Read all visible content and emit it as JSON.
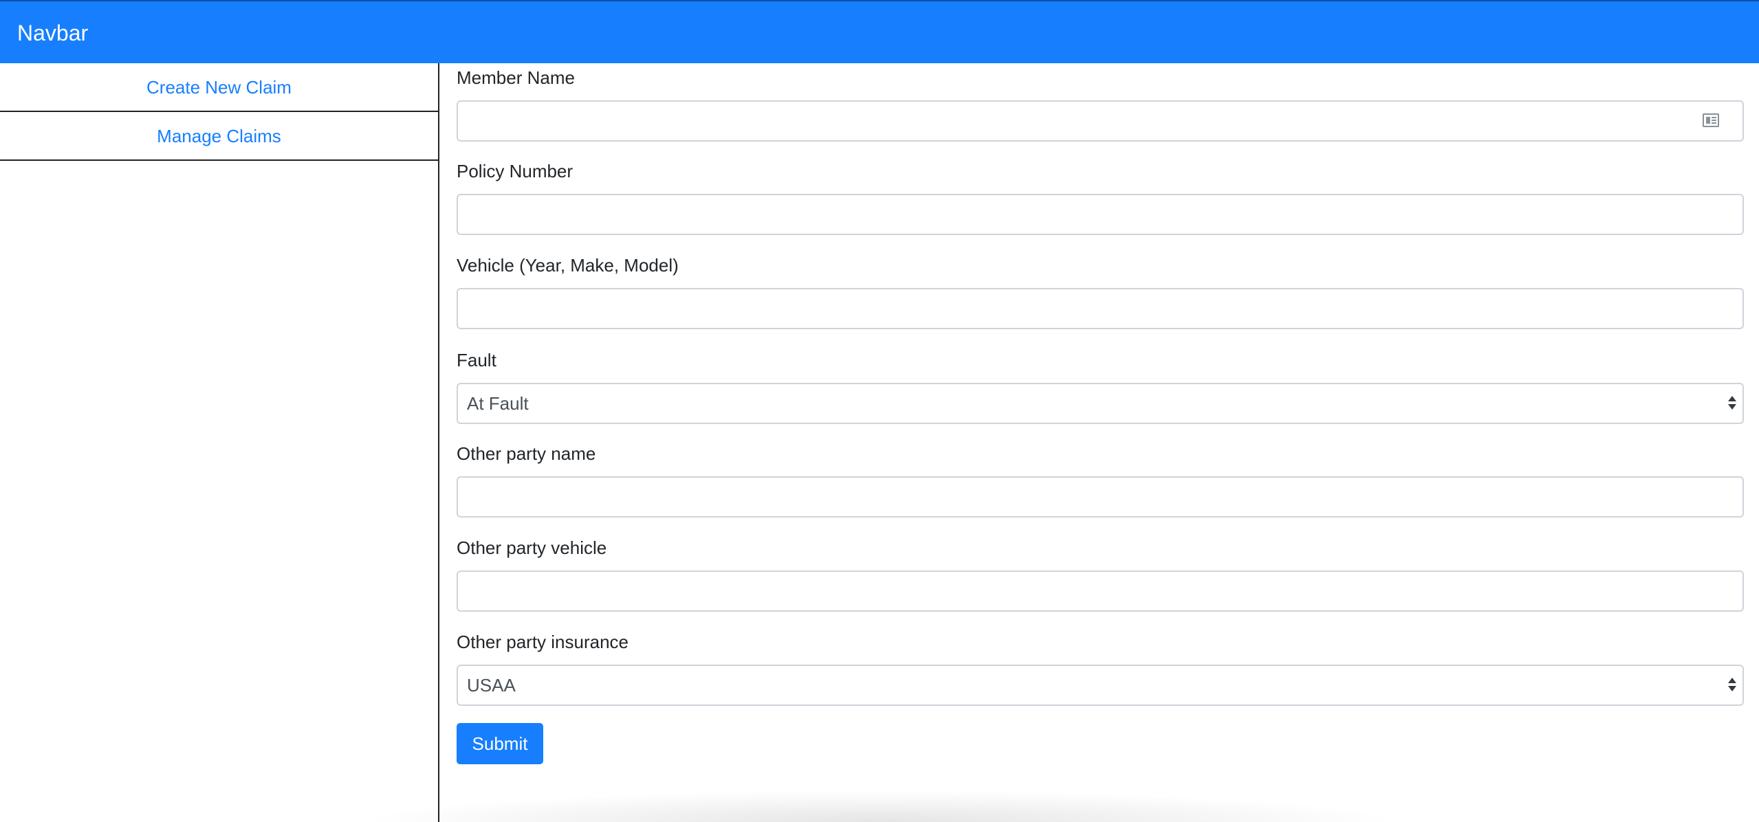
{
  "navbar": {
    "brand": "Navbar"
  },
  "sidebar": {
    "items": [
      {
        "label": "Create New Claim"
      },
      {
        "label": "Manage Claims"
      }
    ]
  },
  "form": {
    "member_name": {
      "label": "Member Name",
      "value": "",
      "icon": "contact-card-icon"
    },
    "policy_number": {
      "label": "Policy Number",
      "value": ""
    },
    "vehicle": {
      "label": "Vehicle (Year, Make, Model)",
      "value": ""
    },
    "fault": {
      "label": "Fault",
      "selected": "At Fault"
    },
    "other_party_name": {
      "label": "Other party name",
      "value": ""
    },
    "other_party_vehicle": {
      "label": "Other party vehicle",
      "value": ""
    },
    "other_party_insurance": {
      "label": "Other party insurance",
      "selected": "USAA"
    },
    "submit_label": "Submit"
  },
  "colors": {
    "primary": "#177ffe",
    "border": "#ced4da",
    "text": "#212529"
  }
}
